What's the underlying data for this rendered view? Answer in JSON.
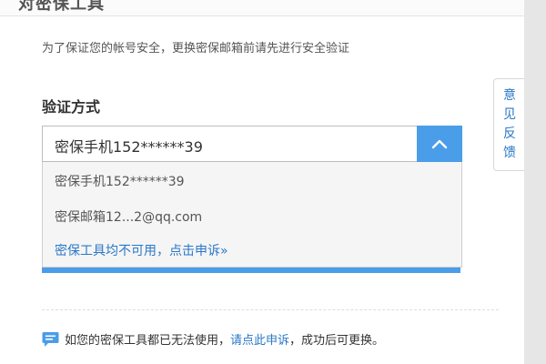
{
  "header": {
    "title": "对密保工具"
  },
  "intro_text": "为了保证您的帐号安全，更换密保邮箱前请先进行安全验证",
  "verification": {
    "label": "验证方式",
    "selected_value": "密保手机152******39",
    "options": [
      "密保手机152******39",
      "密保邮箱12...2@qq.com",
      "密保工具均不可用，点击申诉»"
    ]
  },
  "footer_note": {
    "prefix": "如您的密保工具都已无法使用，",
    "link": "请点此申诉",
    "suffix": "，成功后可更换。"
  },
  "feedback_tab": {
    "chars": [
      "意",
      "见",
      "反",
      "馈"
    ]
  },
  "colors": {
    "accent": "#4a9de8",
    "link": "#2a78c8"
  }
}
